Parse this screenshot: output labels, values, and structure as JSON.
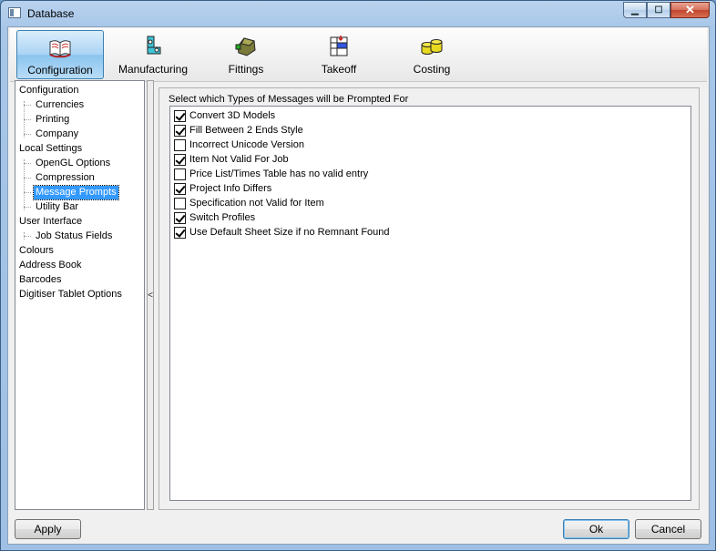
{
  "window": {
    "title": "Database"
  },
  "toolbar": {
    "items": [
      {
        "label": "Configuration",
        "icon": "book-icon"
      },
      {
        "label": "Manufacturing",
        "icon": "manufacturing-icon"
      },
      {
        "label": "Fittings",
        "icon": "fittings-icon"
      },
      {
        "label": "Takeoff",
        "icon": "takeoff-icon"
      },
      {
        "label": "Costing",
        "icon": "coins-icon"
      }
    ]
  },
  "tree": {
    "items": [
      {
        "label": "Configuration",
        "level": 0
      },
      {
        "label": "Currencies",
        "level": 1
      },
      {
        "label": "Printing",
        "level": 1
      },
      {
        "label": "Company",
        "level": 1
      },
      {
        "label": "Local Settings",
        "level": 0
      },
      {
        "label": "OpenGL Options",
        "level": 1
      },
      {
        "label": "Compression",
        "level": 1
      },
      {
        "label": "Message Prompts",
        "level": 1,
        "selected": true
      },
      {
        "label": "Utility Bar",
        "level": 1
      },
      {
        "label": "User Interface",
        "level": 0
      },
      {
        "label": "Job Status Fields",
        "level": 1
      },
      {
        "label": "Colours",
        "level": 0
      },
      {
        "label": "Address Book",
        "level": 0
      },
      {
        "label": "Barcodes",
        "level": 0
      },
      {
        "label": "Digitiser Tablet Options",
        "level": 0
      }
    ]
  },
  "splitter": {
    "glyph": "<"
  },
  "prompts": {
    "title": "Select which Types of Messages will be Prompted For",
    "items": [
      {
        "label": "Convert 3D Models",
        "checked": true
      },
      {
        "label": "Fill Between 2 Ends Style",
        "checked": true
      },
      {
        "label": "Incorrect Unicode Version",
        "checked": false
      },
      {
        "label": "Item Not Valid For Job",
        "checked": true
      },
      {
        "label": "Price List/Times Table has no valid entry",
        "checked": false
      },
      {
        "label": "Project Info Differs",
        "checked": true
      },
      {
        "label": "Specification not Valid for Item",
        "checked": false
      },
      {
        "label": "Switch Profiles",
        "checked": true
      },
      {
        "label": "Use Default Sheet Size if no Remnant Found",
        "checked": true
      }
    ]
  },
  "buttons": {
    "apply": "Apply",
    "ok": "Ok",
    "cancel": "Cancel"
  }
}
